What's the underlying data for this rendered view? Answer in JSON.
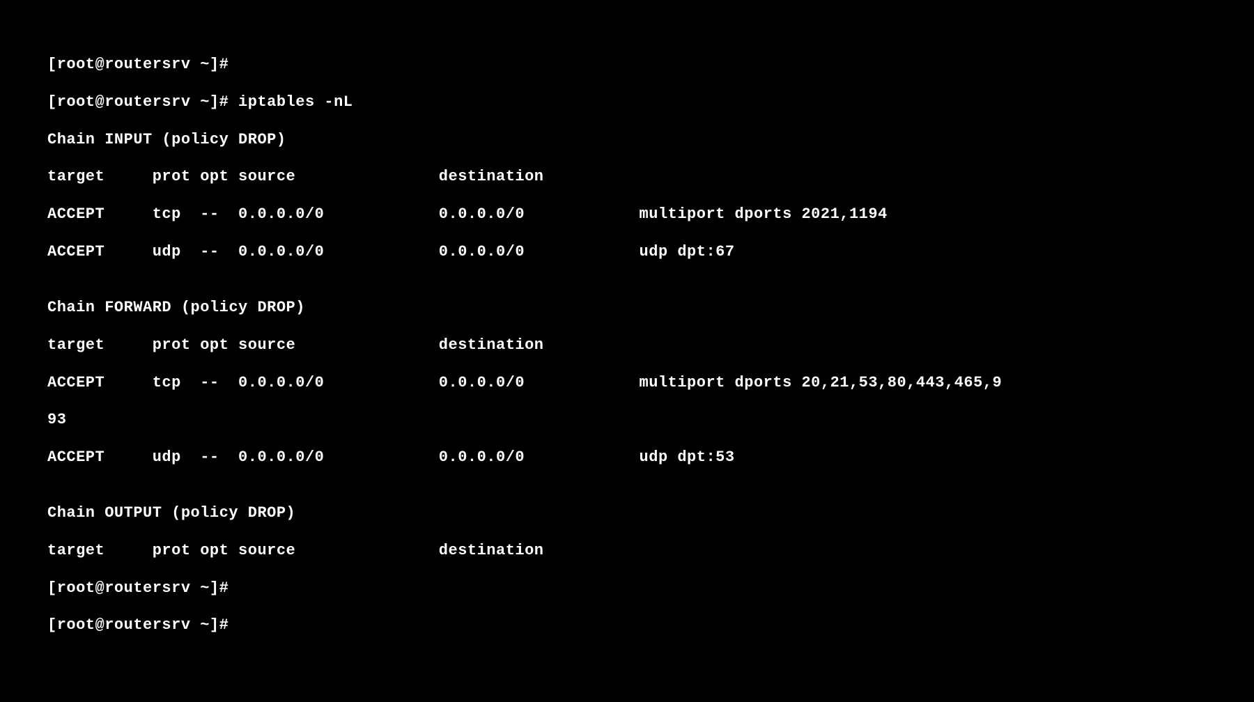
{
  "prompt1": "[root@routersrv ~]#",
  "prompt2_cmd": "[root@routersrv ~]# iptables -nL",
  "chain_input_header": "Chain INPUT (policy DROP)",
  "col_header": "target     prot opt source               destination",
  "input_rule1": "ACCEPT     tcp  --  0.0.0.0/0            0.0.0.0/0            multiport dports 2021,1194",
  "input_rule2": "ACCEPT     udp  --  0.0.0.0/0            0.0.0.0/0            udp dpt:67",
  "blank": "",
  "chain_forward_header": "Chain FORWARD (policy DROP)",
  "forward_rule1": "ACCEPT     tcp  --  0.0.0.0/0            0.0.0.0/0            multiport dports 20,21,53,80,443,465,9",
  "forward_rule1_wrap": "93",
  "forward_rule2": "ACCEPT     udp  --  0.0.0.0/0            0.0.0.0/0            udp dpt:53",
  "chain_output_header": "Chain OUTPUT (policy DROP)",
  "prompt3": "[root@routersrv ~]#",
  "prompt4": "[root@routersrv ~]#"
}
